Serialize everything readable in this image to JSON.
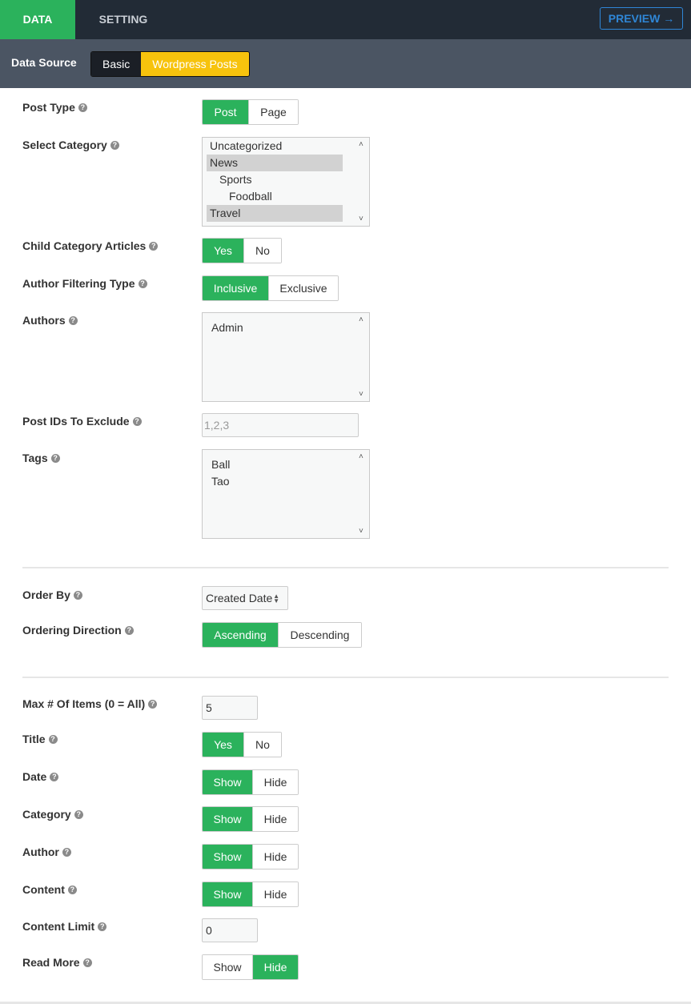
{
  "tabs": {
    "data": "DATA",
    "setting": "SETTING"
  },
  "preview_label": "PREVIEW →",
  "data_source": {
    "label": "Data Source",
    "options": [
      "Basic",
      "Wordpress Posts"
    ],
    "selected": "Wordpress Posts"
  },
  "fields": {
    "post_type": {
      "label": "Post Type",
      "options": [
        "Post",
        "Page"
      ],
      "selected": "Post"
    },
    "select_category": {
      "label": "Select Category",
      "options": [
        "Uncategorized",
        "News",
        "Sports",
        "Foodball",
        "Travel"
      ],
      "selected": [
        "News",
        "Travel"
      ]
    },
    "child_category": {
      "label": "Child Category Articles",
      "options": [
        "Yes",
        "No"
      ],
      "selected": "Yes"
    },
    "author_filtering": {
      "label": "Author Filtering Type",
      "options": [
        "Inclusive",
        "Exclusive"
      ],
      "selected": "Inclusive"
    },
    "authors": {
      "label": "Authors",
      "options": [
        "Admin"
      ]
    },
    "post_ids_exclude": {
      "label": "Post IDs To Exclude",
      "placeholder": "1,2,3"
    },
    "tags": {
      "label": "Tags",
      "options": [
        "Ball",
        "Tao"
      ]
    },
    "order_by": {
      "label": "Order By",
      "value": "Created Date"
    },
    "ordering_direction": {
      "label": "Ordering Direction",
      "options": [
        "Ascending",
        "Descending"
      ],
      "selected": "Ascending"
    },
    "max_items": {
      "label": "Max # Of Items (0 = All)",
      "value": "5"
    },
    "title": {
      "label": "Title",
      "options": [
        "Yes",
        "No"
      ],
      "selected": "Yes"
    },
    "date": {
      "label": "Date",
      "options": [
        "Show",
        "Hide"
      ],
      "selected": "Show"
    },
    "category": {
      "label": "Category",
      "options": [
        "Show",
        "Hide"
      ],
      "selected": "Show"
    },
    "author": {
      "label": "Author",
      "options": [
        "Show",
        "Hide"
      ],
      "selected": "Show"
    },
    "content": {
      "label": "Content",
      "options": [
        "Show",
        "Hide"
      ],
      "selected": "Show"
    },
    "content_limit": {
      "label": "Content Limit",
      "value": "0"
    },
    "read_more": {
      "label": "Read More",
      "options": [
        "Show",
        "Hide"
      ],
      "selected": "Hide"
    }
  },
  "help_glyph": "?",
  "colors": {
    "topbar": "#222b36",
    "accent_green": "#2bb25c",
    "source_bar": "#4b5563",
    "wp_yellow": "#f7c30d",
    "preview_blue": "#2f86d6"
  }
}
